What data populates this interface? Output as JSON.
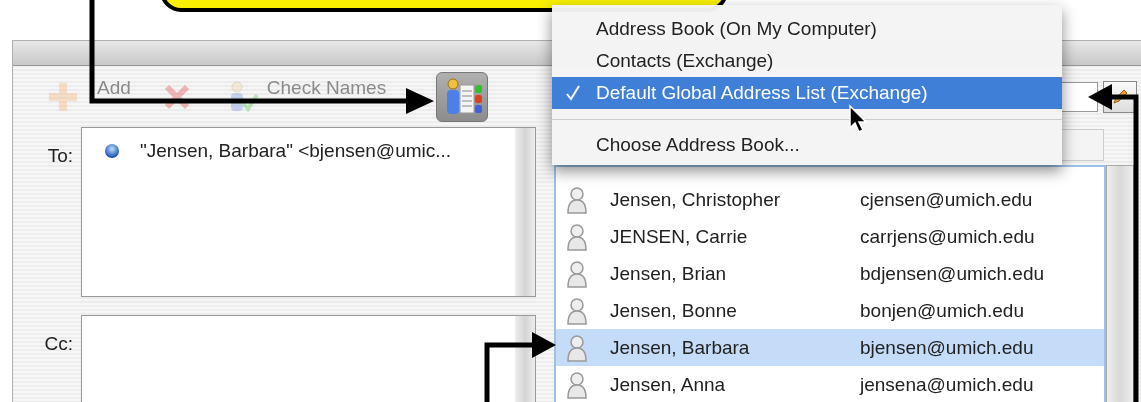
{
  "toolbar": {
    "buttons": [
      {
        "kind": "add",
        "label": "Add",
        "disabled": true
      },
      {
        "kind": "delete",
        "disabled": true
      },
      {
        "kind": "check",
        "label": "Check Names",
        "disabled": true
      },
      {
        "kind": "book",
        "pressed": true
      }
    ]
  },
  "to_field": {
    "label": "To:",
    "recipients": [
      {
        "text": "\"Jensen, Barbara\" <bjensen@umic..."
      }
    ]
  },
  "cc_field": {
    "label": "Cc:"
  },
  "menu": {
    "items": [
      {
        "kind": "item",
        "label": "Address Book (On My Computer)",
        "selected": false
      },
      {
        "kind": "item",
        "label": "Contacts (Exchange)",
        "selected": false
      },
      {
        "kind": "item",
        "label": "Default Global Address List (Exchange)",
        "selected": true
      },
      {
        "kind": "separator"
      },
      {
        "kind": "item",
        "label": "Choose Address Book...",
        "selected": false
      }
    ]
  },
  "contacts": [
    {
      "name": "Jensen, Christopher",
      "email": "cjensen@umich.edu",
      "selected": false
    },
    {
      "name": "JENSEN, Carrie",
      "email": "carrjens@umich.edu",
      "selected": false
    },
    {
      "name": "Jensen, Brian",
      "email": "bdjensen@umich.edu",
      "selected": false
    },
    {
      "name": "Jensen, Bonne",
      "email": "bonjen@umich.edu",
      "selected": false
    },
    {
      "name": "Jensen, Barbara",
      "email": "bjensen@umich.edu",
      "selected": true
    },
    {
      "name": "Jensen, Anna",
      "email": "jensena@umich.edu",
      "selected": false
    }
  ]
}
